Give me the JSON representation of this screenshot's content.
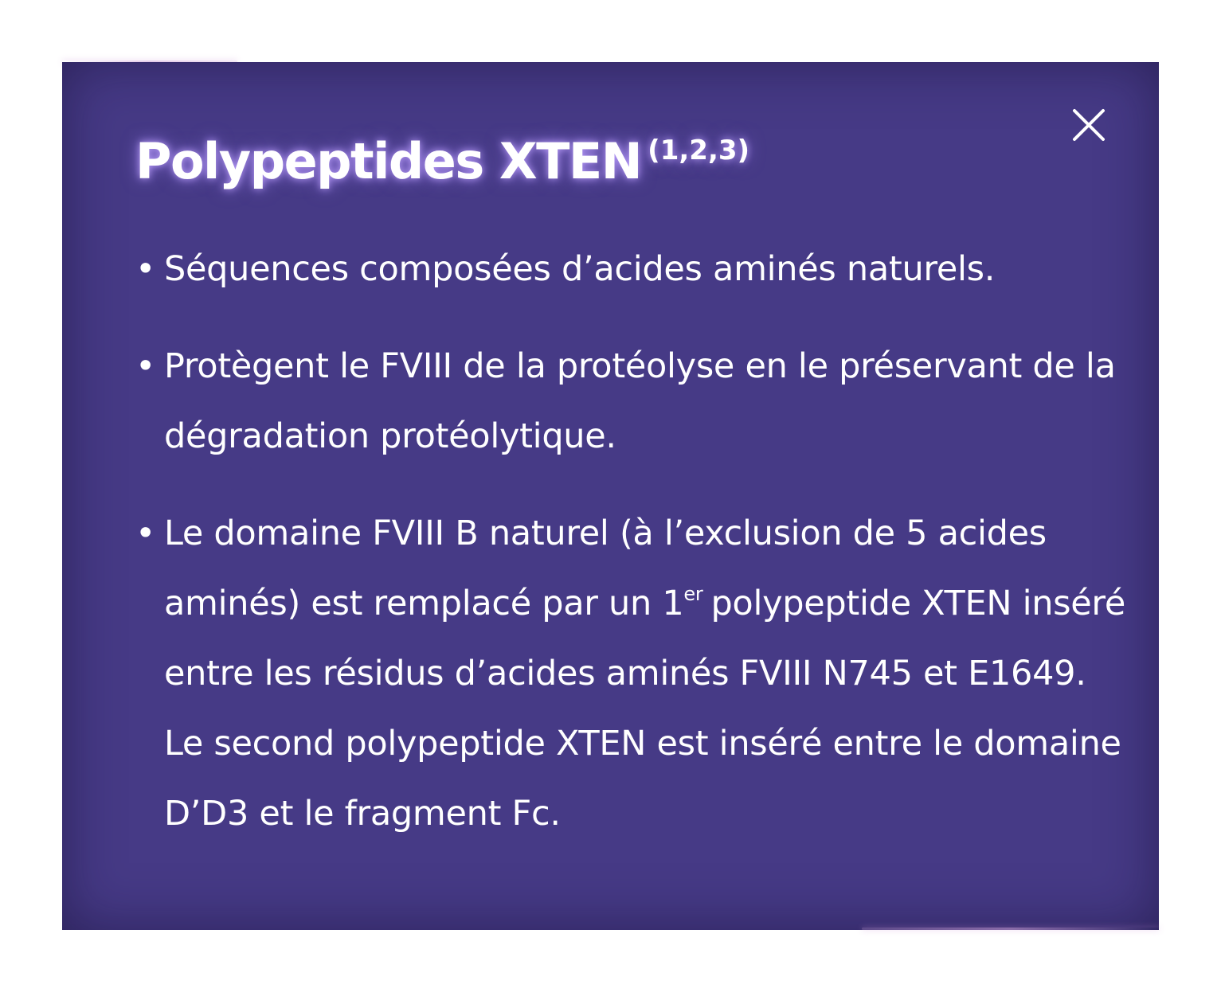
{
  "dialog": {
    "title": "Polypeptides XTEN",
    "title_refs": "(1,2,3)",
    "close_icon": "close-icon",
    "bullet_symbol": "•",
    "items": [
      {
        "text": "Séquences composées d’acides aminés naturels."
      },
      {
        "text": "Protègent le FVIII de la protéolyse en le préservant de la dégradation protéolytique."
      },
      {
        "text_before_sup": "Le domaine FVIII B naturel (à l’exclusion de 5 acides aminés) est remplacé par un 1",
        "sup": "er",
        "text_after_sup": "polypeptide XTEN inséré entre les résidus d’acides aminés FVIII N745 et E1649. Le second polypeptide XTEN est inséré entre le domaine D’D3 et le fragment Fc."
      }
    ]
  },
  "colors": {
    "panel_background": "#463a86",
    "text": "#ffffff",
    "title_glow": "#be a0ff"
  }
}
